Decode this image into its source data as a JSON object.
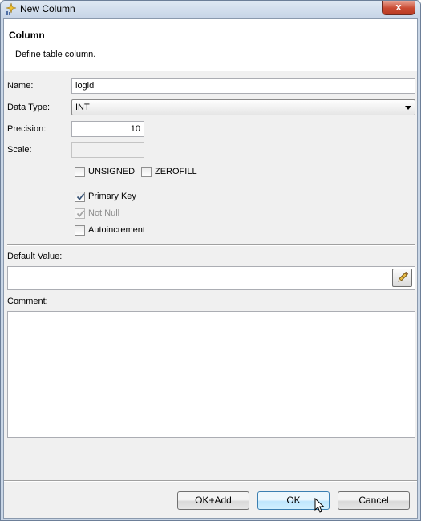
{
  "window": {
    "title": "New Column",
    "close_label": "x"
  },
  "header": {
    "title": "Column",
    "description": "Define table column."
  },
  "form": {
    "name_label": "Name:",
    "name_value": "logid",
    "data_type_label": "Data Type:",
    "data_type_value": "INT",
    "precision_label": "Precision:",
    "precision_value": "10",
    "scale_label": "Scale:",
    "scale_value": "",
    "default_value_label": "Default Value:",
    "default_value": "",
    "comment_label": "Comment:",
    "comment_value": ""
  },
  "checkboxes": [
    {
      "label": "UNSIGNED",
      "checked": false,
      "enabled": true
    },
    {
      "label": "ZEROFILL",
      "checked": false,
      "enabled": true
    },
    {
      "label": "Primary Key",
      "checked": true,
      "enabled": true
    },
    {
      "label": "Not Null",
      "checked": true,
      "enabled": false
    },
    {
      "label": "Autoincrement",
      "checked": false,
      "enabled": true
    }
  ],
  "buttons": {
    "ok_add": "OK+Add",
    "ok": "OK",
    "cancel": "Cancel"
  },
  "icons": {
    "title_icon": "new-column-sparkle-icon",
    "edit_icon": "pencil-icon",
    "cursor_icon": "mouse-pointer-icon"
  },
  "colors": {
    "title_bar": "#c9d6e6",
    "close_button": "#c94a32",
    "dialog_bg": "#f0f0f0",
    "default_button": "#bee6fd"
  }
}
